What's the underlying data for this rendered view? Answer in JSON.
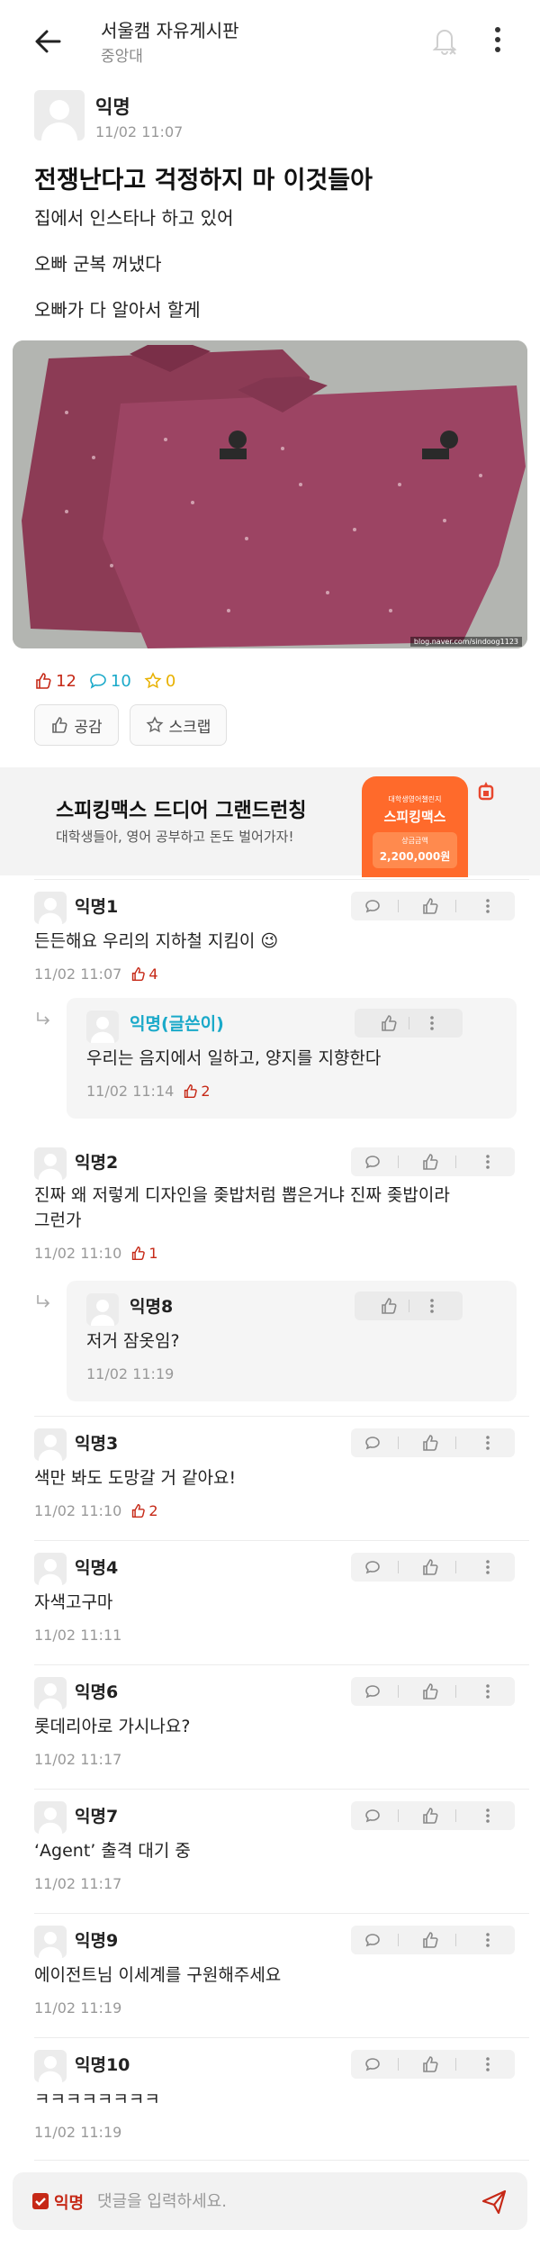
{
  "header": {
    "board_title": "서울캠 자유게시판",
    "school": "중앙대"
  },
  "post": {
    "author": "익명",
    "date": "11/02 11:07",
    "title": "전쟁난다고 걱정하지 마 이것들아",
    "lines": [
      "집에서 인스타나 하고 있어",
      "오빠 군복 꺼냈다",
      "오빠가 다 알아서 할게"
    ],
    "image_credit": "blog.naver.com/sindoog1123",
    "likes": "12",
    "comments": "10",
    "scraps": "0",
    "like_button": "공감",
    "scrap_button": "스크랩"
  },
  "ad": {
    "title": "스피킹맥스 드디어 그랜드런칭",
    "subtitle": "대학생들아, 영어 공부하고 돈도 벌어가자!",
    "phone_small": "대학생영어챌린지",
    "phone_title": "스피킹맥스",
    "prize_label": "상금금액",
    "prize_amount": "2,200,000원"
  },
  "comments": [
    {
      "name": "익명1",
      "text": "든든해요 우리의 지하철 지킴이 😉",
      "time": "11/02 11:07",
      "likes": "4"
    },
    {
      "name": "익명(글쓴이)",
      "text": "우리는 음지에서 일하고, 양지를 지향한다",
      "time": "11/02 11:14",
      "likes": "2"
    },
    {
      "name": "익명2",
      "text1": "진짜 왜 저렇게 디자인을 좆밥처럼 뽑은거냐 진짜 좆밥이라",
      "text2": "그런가",
      "time": "11/02 11:10",
      "likes": "1"
    },
    {
      "name": "익명8",
      "text": "저거 잠옷임?",
      "time": "11/02 11:19"
    },
    {
      "name": "익명3",
      "text": "색만 봐도 도망갈 거 같아요!",
      "time": "11/02 11:10",
      "likes": "2"
    },
    {
      "name": "익명4",
      "text": "자색고구마",
      "time": "11/02 11:11"
    },
    {
      "name": "익명6",
      "text": "롯데리아로 가시나요?",
      "time": "11/02 11:17"
    },
    {
      "name": "익명7",
      "text": "‘Agent’ 출격 대기 중",
      "time": "11/02 11:17"
    },
    {
      "name": "익명9",
      "text": "에이전트님 이세계를 구원해주세요",
      "time": "11/02 11:19"
    },
    {
      "name": "익명10",
      "text": "ㅋㅋㅋㅋㅋㅋㅋㅋ",
      "time": "11/02 11:19"
    }
  ],
  "bottom": {
    "anon_label": "익명",
    "placeholder": "댓글을 입력하세요."
  },
  "colors": {
    "like": "#c62917",
    "comment": "#1aa9c9",
    "scrap": "#e8b100",
    "author_highlight": "#1aa9c9"
  },
  "icons": [
    "back-arrow-icon",
    "bell-off-icon",
    "more-vertical-icon",
    "thumbs-up-icon",
    "speech-bubble-icon",
    "star-icon",
    "reply-arrow-icon",
    "send-icon",
    "avatar-icon"
  ]
}
